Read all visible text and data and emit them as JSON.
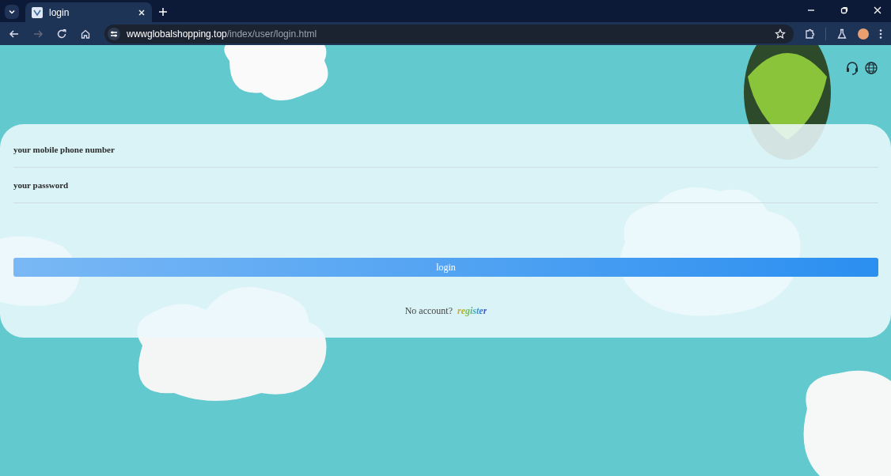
{
  "browser": {
    "tab": {
      "title": "login",
      "selected": true
    },
    "url": {
      "host": "wwwglobalshopping.top",
      "path": "/index/user/login.html"
    }
  },
  "form": {
    "fields": [
      {
        "placeholder": "your mobile phone number"
      },
      {
        "placeholder": "your password"
      }
    ],
    "submit": "login",
    "prompt": "No account?",
    "link": "register"
  }
}
